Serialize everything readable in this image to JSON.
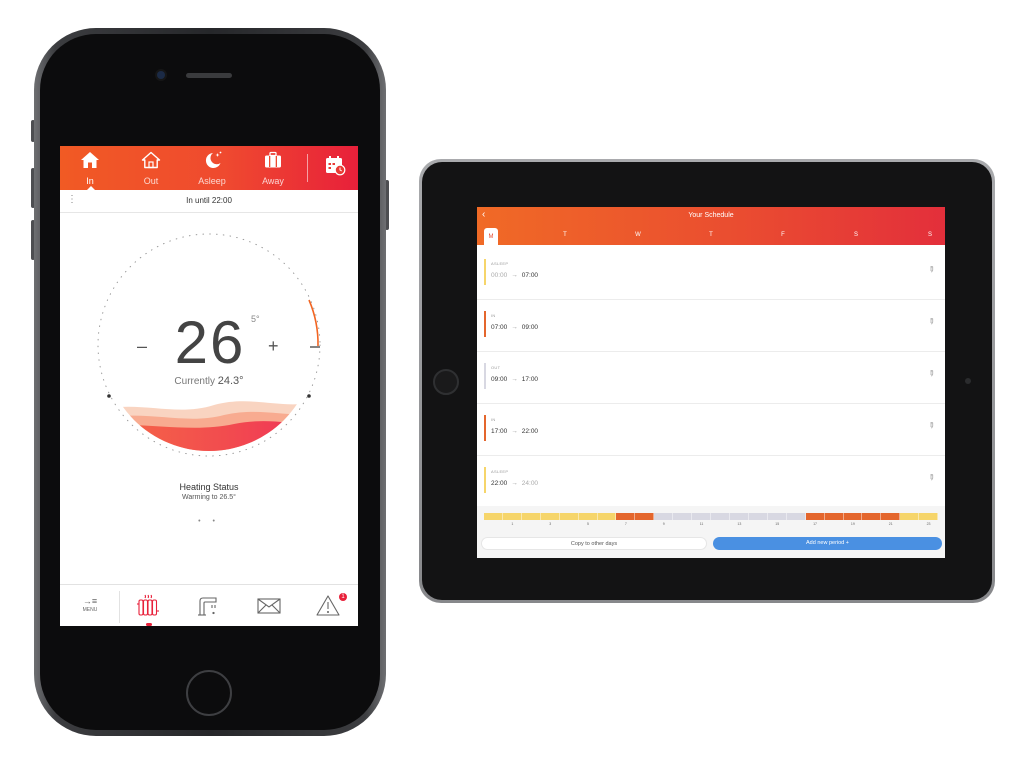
{
  "phone": {
    "modes": [
      {
        "label": "In",
        "icon": "home-icon"
      },
      {
        "label": "Out",
        "icon": "home-outline-icon"
      },
      {
        "label": "Asleep",
        "icon": "moon-icon"
      },
      {
        "label": "Away",
        "icon": "suitcase-icon"
      }
    ],
    "schedule_icon": "calendar-icon",
    "until_text": "In until 22:00",
    "target_temp": "26",
    "step_label": "5°",
    "minus": "–",
    "plus": "+",
    "currently_label": "Currently",
    "currently_value": "24.3°",
    "heating_title": "Heating Status",
    "heating_sub": "Warming to 26.5°",
    "page_dots": "• •",
    "menu_label": "MENU",
    "menu_arrow": "→≡",
    "bottom_icons": [
      "radiator-icon",
      "tap-icon",
      "mail-icon",
      "alert-icon"
    ],
    "alert_count": "1",
    "colors": {
      "accent": "#ef4a2f",
      "accent_end": "#e8203a"
    }
  },
  "ipad": {
    "title": "Your Schedule",
    "back": "‹",
    "days": [
      "M",
      "T",
      "W",
      "T",
      "F",
      "S",
      "S"
    ],
    "active_day": 0,
    "periods": [
      {
        "name": "ASLEEP",
        "start": "00:00",
        "end": "07:00",
        "color": "#f6d56a",
        "start_muted": true,
        "end_muted": false
      },
      {
        "name": "IN",
        "start": "07:00",
        "end": "09:00",
        "color": "#e4662d",
        "start_muted": false,
        "end_muted": false
      },
      {
        "name": "OUT",
        "start": "09:00",
        "end": "17:00",
        "color": "#d8d8e2",
        "start_muted": false,
        "end_muted": false
      },
      {
        "name": "IN",
        "start": "17:00",
        "end": "22:00",
        "color": "#e4662d",
        "start_muted": false,
        "end_muted": false
      },
      {
        "name": "ASLEEP",
        "start": "22:00",
        "end": "24:00",
        "color": "#f6d56a",
        "start_muted": false,
        "end_muted": true
      }
    ],
    "timeline_ticks": [
      "1",
      "3",
      "5",
      "7",
      "9",
      "11",
      "13",
      "15",
      "17",
      "19",
      "21",
      "23"
    ],
    "copy_label": "Copy to other days",
    "add_label": "Add new period +",
    "edit_glyph": "✎",
    "arrow_glyph": "→"
  }
}
